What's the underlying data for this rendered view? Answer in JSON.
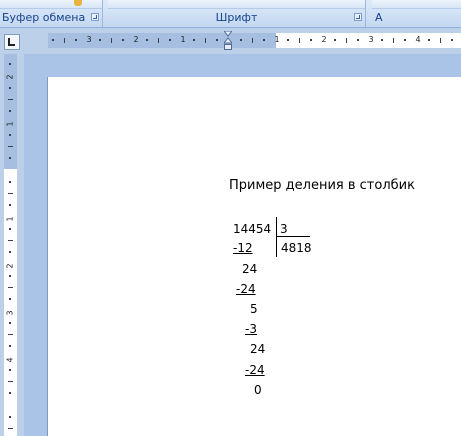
{
  "ribbon": {
    "groups": [
      {
        "label": "Буфер обмена"
      },
      {
        "label": "Шрифт"
      },
      {
        "label": "А"
      }
    ]
  },
  "ruler": {
    "horizontal_labels": [
      "3",
      "2",
      "1",
      "1",
      "2",
      "3",
      "4"
    ],
    "vertical_labels": [
      "2",
      "1",
      "1",
      "2",
      "3",
      "4"
    ]
  },
  "document": {
    "title": "Пример деления в столбик",
    "division": {
      "dividend": "14454",
      "divisor": "3",
      "quotient": "4818",
      "steps": [
        "-12",
        "24",
        "-24",
        "5",
        "-3",
        "24",
        "-24",
        "0"
      ]
    }
  }
}
